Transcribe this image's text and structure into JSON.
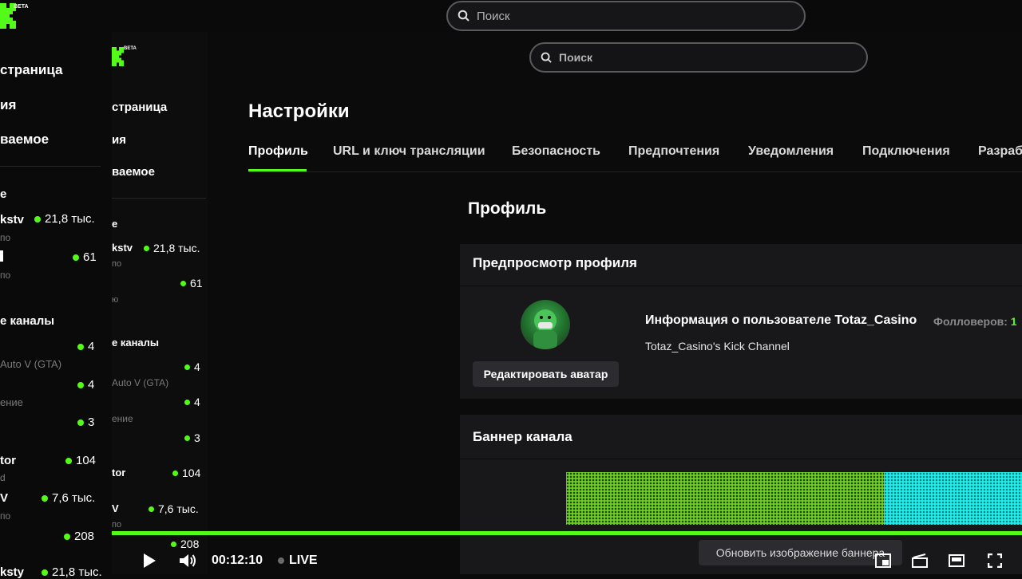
{
  "outer": {
    "logo_badge": "BETA",
    "search_placeholder": "Поиск",
    "nav": [
      "страница",
      "ия",
      "ваемое"
    ],
    "section_following": "е",
    "section_recommended": "е каналы",
    "channels": [
      {
        "name": "kstv",
        "sub": "по",
        "count": "21,8 тыс."
      },
      {
        "name": "",
        "sub": "по",
        "count": "61"
      },
      {
        "name": "",
        "sub": "Auto V (GTA)",
        "count": "4"
      },
      {
        "name": "",
        "sub": "ение",
        "count": "4"
      },
      {
        "name": "",
        "sub": "",
        "count": "3"
      },
      {
        "name": "tor",
        "sub": "d",
        "count": "104"
      },
      {
        "name": "V",
        "sub": "по",
        "count": "7,6 тыс."
      },
      {
        "name": "",
        "sub": "",
        "count": "208"
      },
      {
        "name": "ksty",
        "sub": "",
        "count": "21,8 тыс."
      }
    ]
  },
  "inner": {
    "logo_badge": "BETA",
    "search_placeholder": "Поиск",
    "nav": [
      "страница",
      "ия",
      "ваемое"
    ],
    "section_following": "е",
    "section_recommended": "е каналы",
    "channels": [
      {
        "name": "kstv",
        "sub": "по",
        "count": "21,8 тыс."
      },
      {
        "name": "",
        "sub": "ю",
        "count": "61"
      },
      {
        "name": "",
        "sub": "Auto V (GTA)",
        "count": "4"
      },
      {
        "name": "",
        "sub": "ение",
        "count": "4"
      },
      {
        "name": "",
        "sub": "",
        "count": "3"
      },
      {
        "name": "tor",
        "sub": "",
        "count": "104"
      },
      {
        "name": "V",
        "sub": "по",
        "count": "7,6 тыс."
      },
      {
        "name": "",
        "sub": "",
        "count": "208"
      }
    ],
    "page_title": "Настройки",
    "tabs": [
      {
        "label": "Профиль",
        "active": true
      },
      {
        "label": "URL и ключ трансляции"
      },
      {
        "label": "Безопасность"
      },
      {
        "label": "Предпочтения"
      },
      {
        "label": "Уведомления"
      },
      {
        "label": "Подключения"
      },
      {
        "label": "Разраб"
      }
    ],
    "section_title": "Профиль",
    "preview": {
      "title": "Предпросмотр профиля",
      "edit_avatar": "Редактировать аватар",
      "user_info": "Информация о пользователе Totaz_Casino",
      "followers_label": "Фолловеров:",
      "followers_count": "1",
      "description": "Totaz_Casino's Kick Channel"
    },
    "banner": {
      "title": "Баннер канала",
      "update_button": "Обновить изображение баннера"
    }
  },
  "player": {
    "time": "00:12:10",
    "live_label": "LIVE",
    "accent": "#53fc18"
  }
}
